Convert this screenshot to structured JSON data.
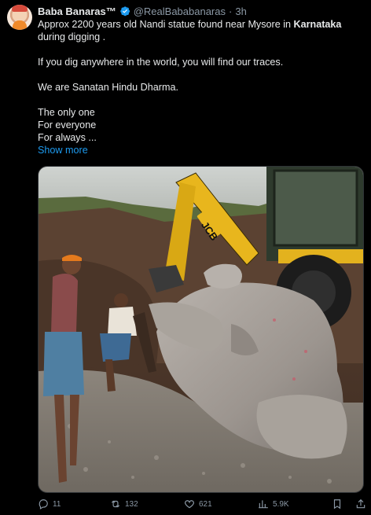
{
  "author": {
    "display_name": "Baba Banaras™",
    "handle": "@RealBababanaras",
    "separator": "·",
    "time": "3h"
  },
  "tweet": {
    "line1_pre": "Approx 2200 years old Nandi statue found near Mysore in ",
    "line1_bold": "Karnataka",
    "line2": "during digging .",
    "para2": "If you dig anywhere in the world, you will find our traces.",
    "para3": "We are Sanatan Hindu Dharma.",
    "line_a": "The only one",
    "line_b": "For everyone",
    "line_c": "For always ...",
    "show_more": "Show more"
  },
  "media": {
    "excavator_brand": "JCB"
  },
  "actions": {
    "replies": "11",
    "reposts": "132",
    "likes": "621",
    "views": "5.9K"
  },
  "icons": [
    "verified-badge-icon",
    "reply-icon",
    "repost-icon",
    "like-icon",
    "views-icon",
    "bookmark-icon",
    "share-icon"
  ],
  "colors": {
    "accent": "#1d9bf0",
    "text": "#e7e9ea",
    "muted": "#8b98a5",
    "background": "#000000"
  }
}
